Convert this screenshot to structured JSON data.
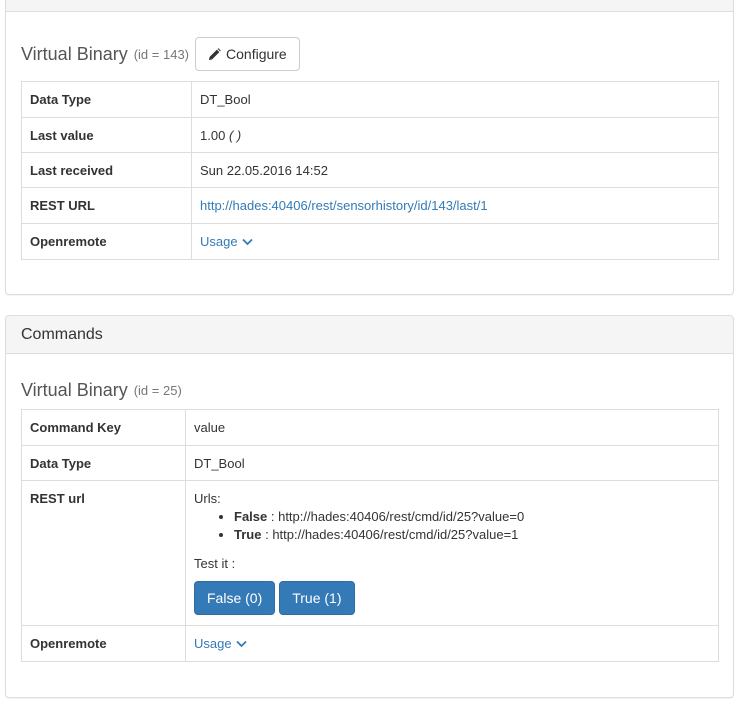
{
  "sensor": {
    "title": "Virtual Binary",
    "id_text": "(id = 143)",
    "configure_label": "Configure",
    "rows": [
      {
        "key": "Data Type",
        "value": "DT_Bool"
      },
      {
        "key": "Last value",
        "value": "1.00",
        "unit": "( )"
      },
      {
        "key": "Last received",
        "value": "Sun 22.05.2016 14:52"
      },
      {
        "key": "REST URL",
        "value": "http://hades:40406/rest/sensorhistory/id/143/last/1"
      },
      {
        "key": "Openremote",
        "value": "Usage"
      }
    ]
  },
  "commands": {
    "heading": "Commands",
    "title": "Virtual Binary",
    "id_text": "(id = 25)",
    "rows": {
      "command_key": {
        "key": "Command Key",
        "value": "value"
      },
      "data_type": {
        "key": "Data Type",
        "value": "DT_Bool"
      },
      "rest_url": {
        "key": "REST url",
        "urls_label": "Urls:",
        "urls": [
          {
            "name": "False",
            "sep": " : ",
            "url": "http://hades:40406/rest/cmd/id/25?value=0"
          },
          {
            "name": "True",
            "sep": " : ",
            "url": "http://hades:40406/rest/cmd/id/25?value=1"
          }
        ],
        "test_label": "Test it :",
        "buttons": [
          "False (0)",
          "True (1)"
        ]
      },
      "openremote": {
        "key": "Openremote",
        "value": "Usage"
      }
    }
  },
  "colors": {
    "link": "#337ab7",
    "primary_button": "#337ab7",
    "panel_heading_bg": "#f5f5f5",
    "border": "#dddddd"
  },
  "icons": {
    "configure": "pencil-icon",
    "usage": "chevron-down-icon"
  }
}
